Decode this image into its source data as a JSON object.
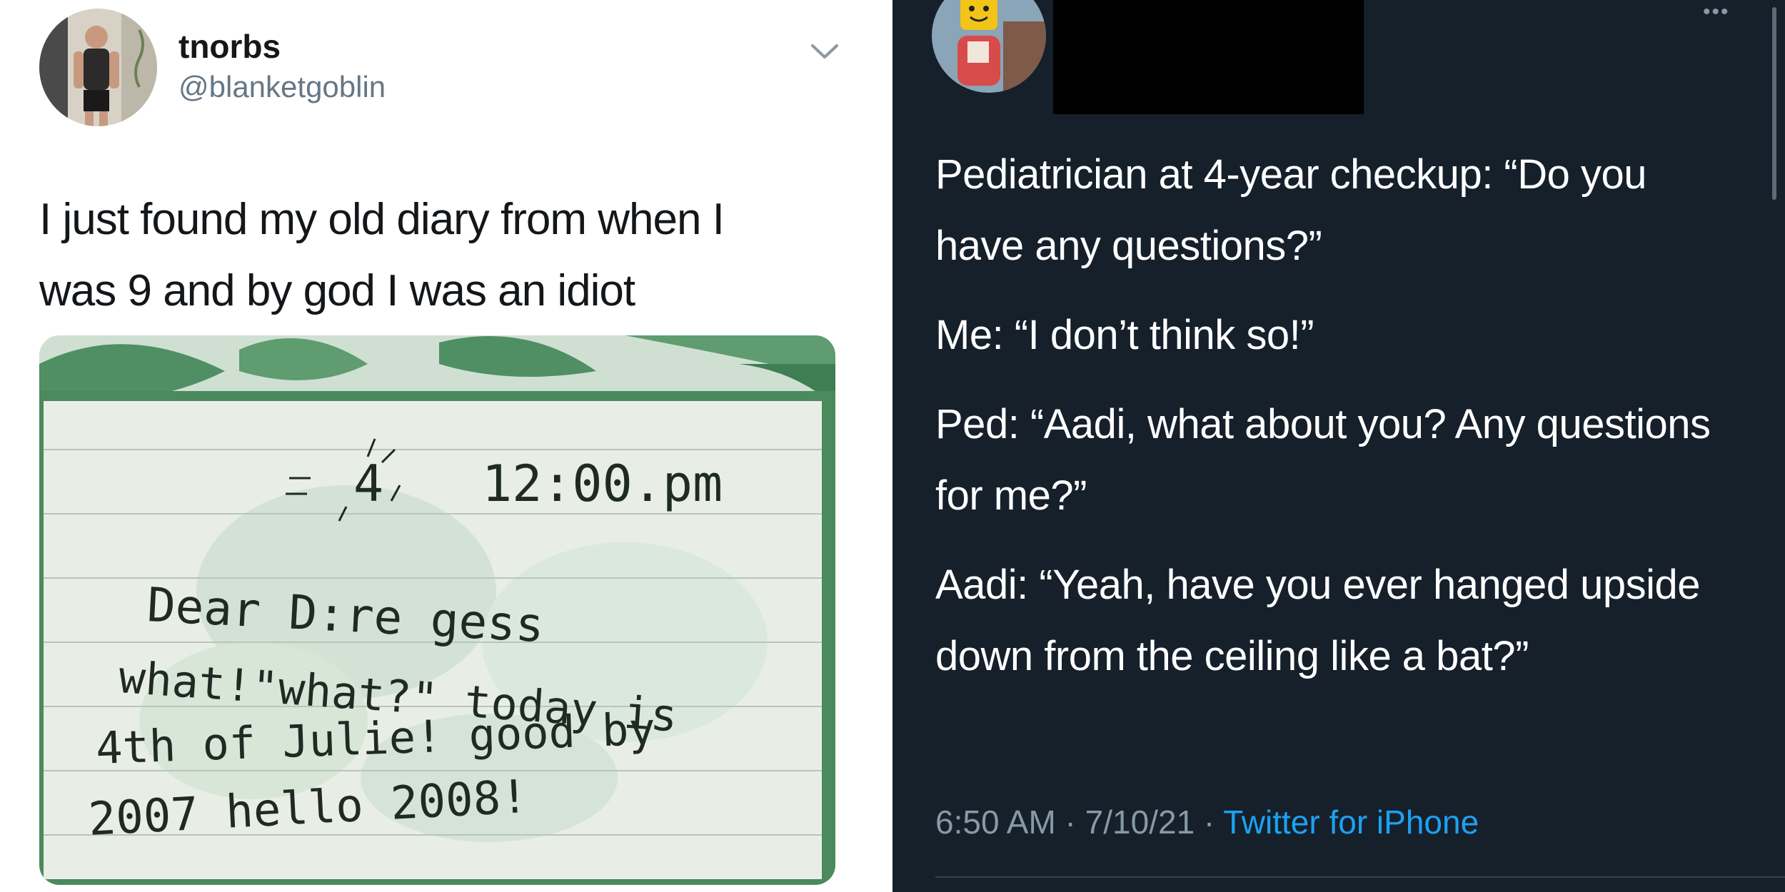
{
  "left_tweet": {
    "display_name": "tnorbs",
    "handle": "@blanketgoblin",
    "text_line1": "I just found my old diary from when I",
    "text_line2": "was 9 and by god I was an idiot",
    "icons": {
      "menu": "chevron-down-icon"
    },
    "diary_note": {
      "time": "12:00.pm",
      "line1": "Dear D:re gess",
      "line2": "what!\"what?\" today is",
      "line3": "4th of Julie! good by",
      "line4": "2007 hello 2008!"
    }
  },
  "right_tweet": {
    "paragraphs": [
      "Pediatrician at 4-year checkup: “Do you have any questions?”",
      "Me: “I don’t think so!”",
      "Ped: “Aadi, what about you? Any questions for me?”",
      "Aadi: “Yeah, have you ever hanged upside down from the ceiling like a bat?”"
    ],
    "time": "6:50 AM",
    "date": "7/10/21",
    "source": "Twitter for iPhone",
    "separator": " · ",
    "more_icon": "ellipsis-icon"
  },
  "colors": {
    "left_background": "#ffffff",
    "right_background": "#15202b",
    "link_blue": "#1da1f2",
    "muted_text": "#8899a6"
  }
}
